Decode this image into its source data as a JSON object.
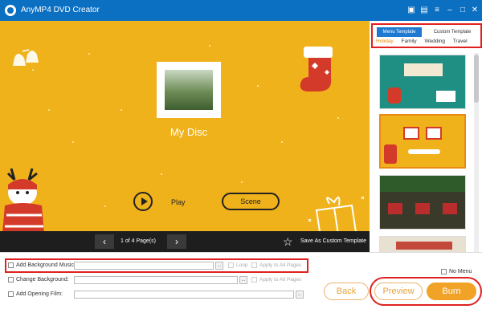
{
  "app": {
    "title": "AnyMP4 DVD Creator"
  },
  "titlebar": {
    "icons": [
      "cart-icon",
      "feedback-icon",
      "menu-icon",
      "minimize-icon",
      "maximize-icon",
      "close-icon"
    ]
  },
  "preview": {
    "disc_title": "My Disc",
    "play_label": "Play",
    "scene_label": "Scene"
  },
  "pagebar": {
    "prev": "‹",
    "next": "›",
    "page_info": "1 of 4 Page(s)",
    "save_template": "Save As Custom Template"
  },
  "template_panel": {
    "tabs": [
      {
        "label": "Menu Template",
        "active": true
      },
      {
        "label": "Custom Template",
        "active": false
      }
    ],
    "categories": [
      {
        "label": "Holiday",
        "active": true
      },
      {
        "label": "Family"
      },
      {
        "label": "Wedding"
      },
      {
        "label": "Travel"
      }
    ]
  },
  "options": {
    "background_music_label": "Add Background Music:",
    "loop_label": "Loop",
    "apply_all_label": "Apply to All Pages",
    "change_background_label": "Change Background:",
    "opening_film_label": "Add Opening Film:",
    "no_menu_label": "No Menu",
    "browse": "..."
  },
  "actions": {
    "back": "Back",
    "preview": "Preview",
    "burn": "Burn"
  },
  "colors": {
    "accent": "#1f78d1",
    "orange": "#f0a326",
    "preview_bg": "#f0b21a",
    "highlight": "#e02020"
  }
}
